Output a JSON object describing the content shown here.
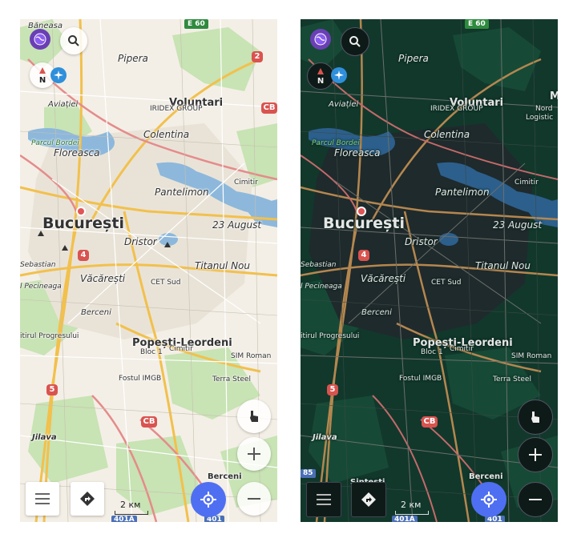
{
  "labels": {
    "baneasa": "Băneasa",
    "pipera": "Pipera",
    "voluntari": "Voluntari",
    "iridex": "IRIDEX GROUP",
    "aviatiei": "Aviației",
    "colentina": "Colentina",
    "parcul_bordei": "Parcul Bordei",
    "floreasca": "Floreasca",
    "pantelimon": "Pantelimon",
    "cimitir": "Cimitir",
    "bucuresti": "București",
    "august": "23 August",
    "dristor": "Dristor",
    "sebastian": "Sebastian",
    "titanul": "Titanul Nou",
    "pecineaga": "l Pecineaga",
    "vacaresti": "Văcărești",
    "cet_sud": "CET Sud",
    "berceni": "Berceni",
    "progresului": "itirul Progresului",
    "popesti": "Popești-Leordeni",
    "bloc1": "Bloc 1",
    "cimitir2": "Cimitir",
    "sim_roman": "SIM Roman",
    "imgb": "Fostul IMGB",
    "terra": "Terra Steel",
    "jilava": "Jilava",
    "berceni2": "Berceni",
    "sintesti": "Sintești",
    "nord": "Nord",
    "logistic": "Logistic",
    "m": "M"
  },
  "shields": {
    "e60": "E 60",
    "r2": "2",
    "cb": "CB",
    "r4": "4",
    "r5": "5",
    "cb2": "CB",
    "r401a": "401A",
    "r401": "401",
    "r85": "85"
  },
  "controls": {
    "compass_letter": "N",
    "scale_text": "2 км"
  },
  "colors": {
    "accent": "#4f6ff2",
    "light_map_bg": "#f3efe6",
    "dark_map_bg": "#12382c"
  },
  "icons": [
    "globe-icon",
    "search-icon",
    "compass-icon",
    "airplane-icon",
    "hand-icon",
    "plus-icon",
    "minus-icon",
    "menu-icon",
    "route-icon",
    "my-location-icon"
  ]
}
